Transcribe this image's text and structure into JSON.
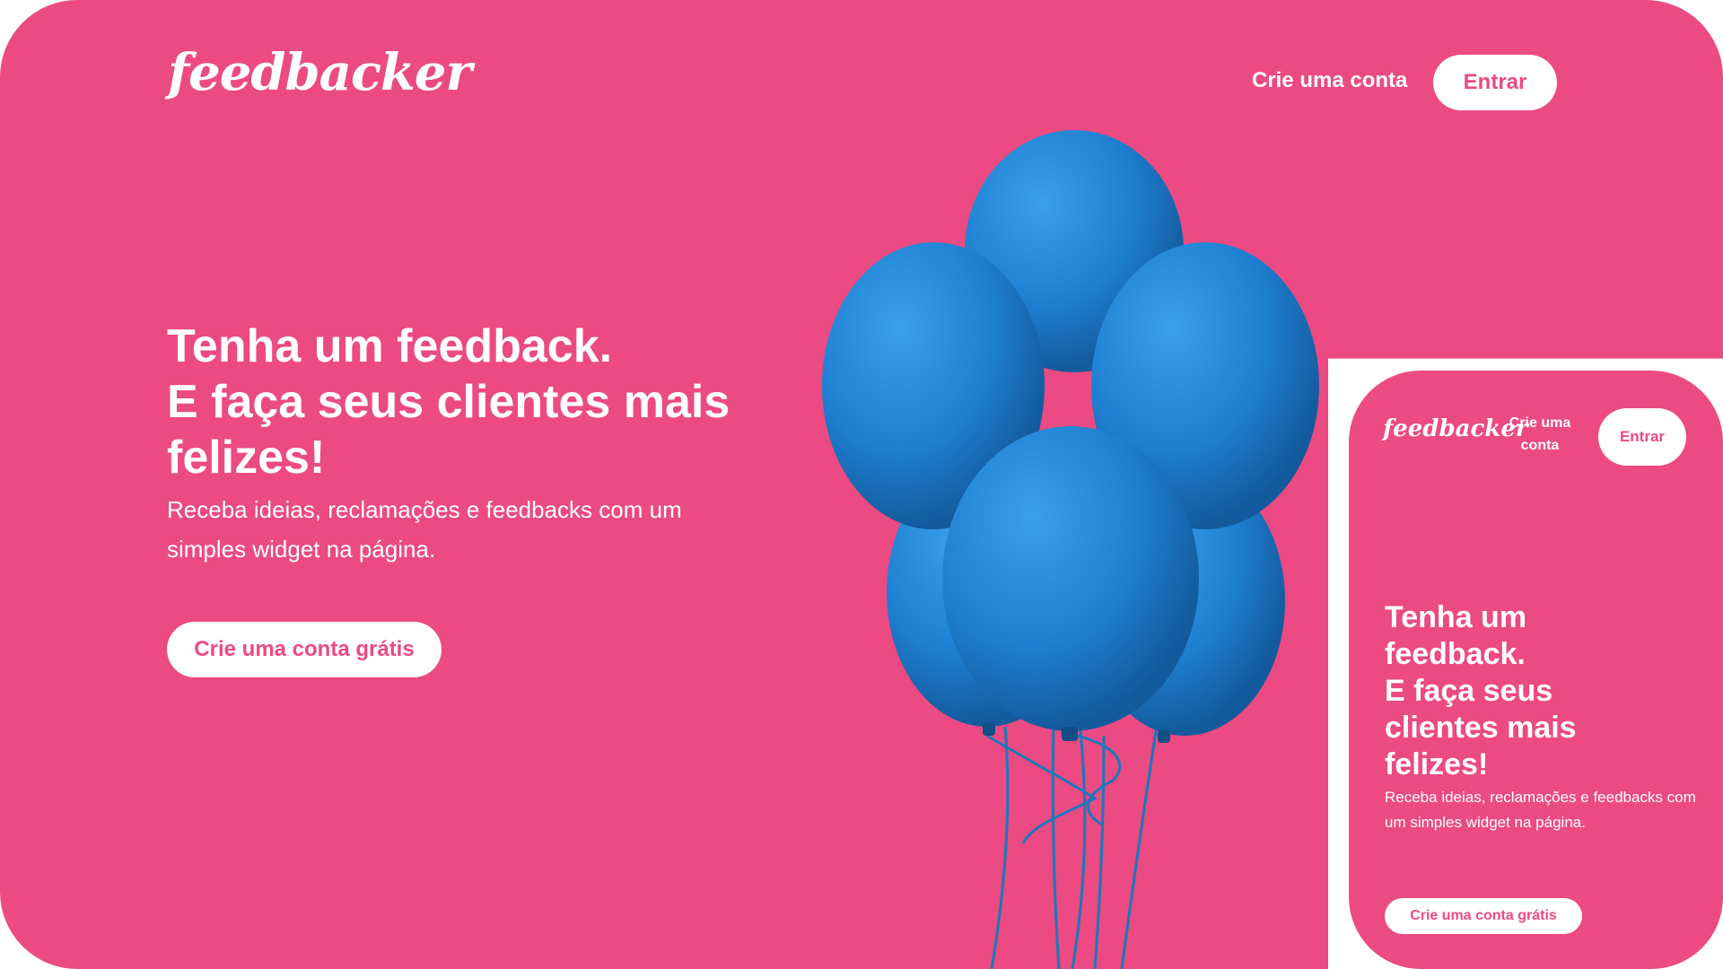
{
  "colors": {
    "brand_pink": "#ec4a82",
    "balloon_blue": "#1e7fd0",
    "white": "#ffffff"
  },
  "desktop": {
    "logo": "feedbacker",
    "nav": {
      "create_account": "Crie uma conta",
      "login": "Entrar"
    },
    "hero": {
      "title_line1": "Tenha um feedback.",
      "title_line2": "E faça seus clientes mais felizes!",
      "subtitle": "Receba ideias, reclamações e feedbacks com um simples widget na página.",
      "cta": "Crie uma conta grátis"
    },
    "illustration": "balloons-illustration"
  },
  "mobile": {
    "logo": "feedbacker",
    "nav": {
      "create_account": "Crie uma conta",
      "login": "Entrar"
    },
    "hero": {
      "title_line1": "Tenha um feedback.",
      "title_line2": "E faça seus clientes mais felizes!",
      "subtitle": "Receba ideias, reclamações e feedbacks com um simples widget na página.",
      "cta": "Crie uma conta grátis"
    }
  }
}
